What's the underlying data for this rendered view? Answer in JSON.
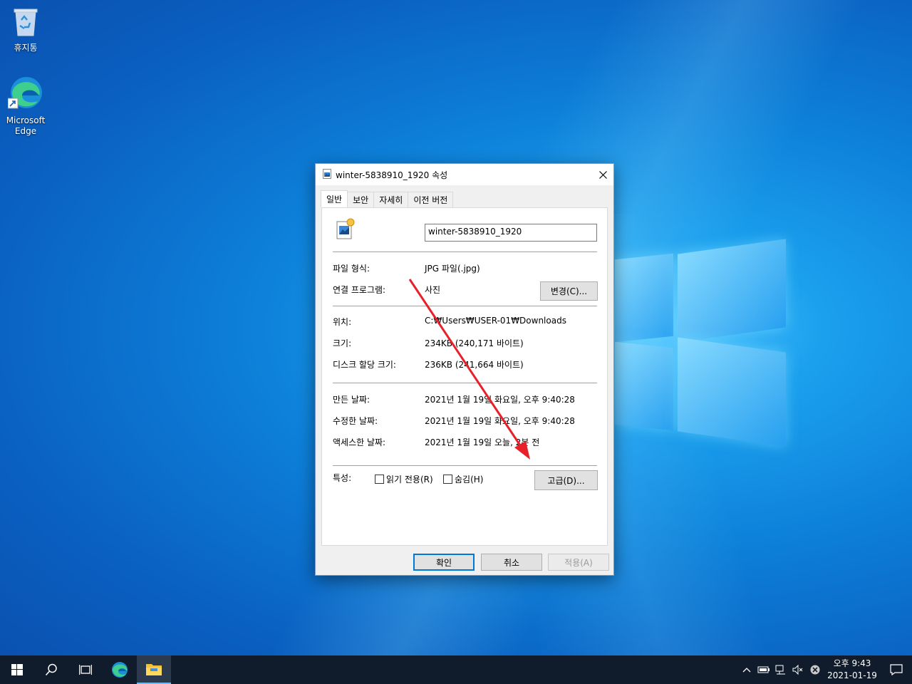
{
  "desktop": {
    "icons": [
      {
        "label": "휴지통"
      },
      {
        "label": "Microsoft Edge"
      }
    ]
  },
  "dialog": {
    "title": "winter-5838910_1920 속성",
    "tabs": [
      "일반",
      "보안",
      "자세히",
      "이전 버전"
    ],
    "active_tab": "일반",
    "file_name": "winter-5838910_1920",
    "fields": {
      "file_type_label": "파일 형식:",
      "file_type_value": "JPG 파일(.jpg)",
      "opens_with_label": "연결 프로그램:",
      "opens_with_value": "사진",
      "change_button": "변경(C)...",
      "location_label": "위치:",
      "location_value": "C:₩Users₩USER-01₩Downloads",
      "size_label": "크기:",
      "size_value": "234KB (240,171 바이트)",
      "size_on_disk_label": "디스크 할당 크기:",
      "size_on_disk_value": "236KB (241,664 바이트)",
      "created_label": "만든 날짜:",
      "created_value": "2021년 1월 19일 화요일, 오후 9:40:28",
      "modified_label": "수정한 날짜:",
      "modified_value": "2021년 1월 19일 화요일, 오후 9:40:28",
      "accessed_label": "액세스한 날짜:",
      "accessed_value": "2021년 1월 19일 오늘, 2분 전",
      "attributes_label": "특성:",
      "readonly_label": "읽기 전용(R)",
      "hidden_label": "숨김(H)",
      "advanced_button": "고급(D)..."
    },
    "buttons": {
      "ok": "확인",
      "cancel": "취소",
      "apply": "적용(A)"
    }
  },
  "taskbar": {
    "clock_time": "오후 9:43",
    "clock_date": "2021-01-19"
  },
  "colors": {
    "annotation_arrow": "#e8202a",
    "accent": "#0078d7",
    "taskbar": "#101c2b"
  }
}
